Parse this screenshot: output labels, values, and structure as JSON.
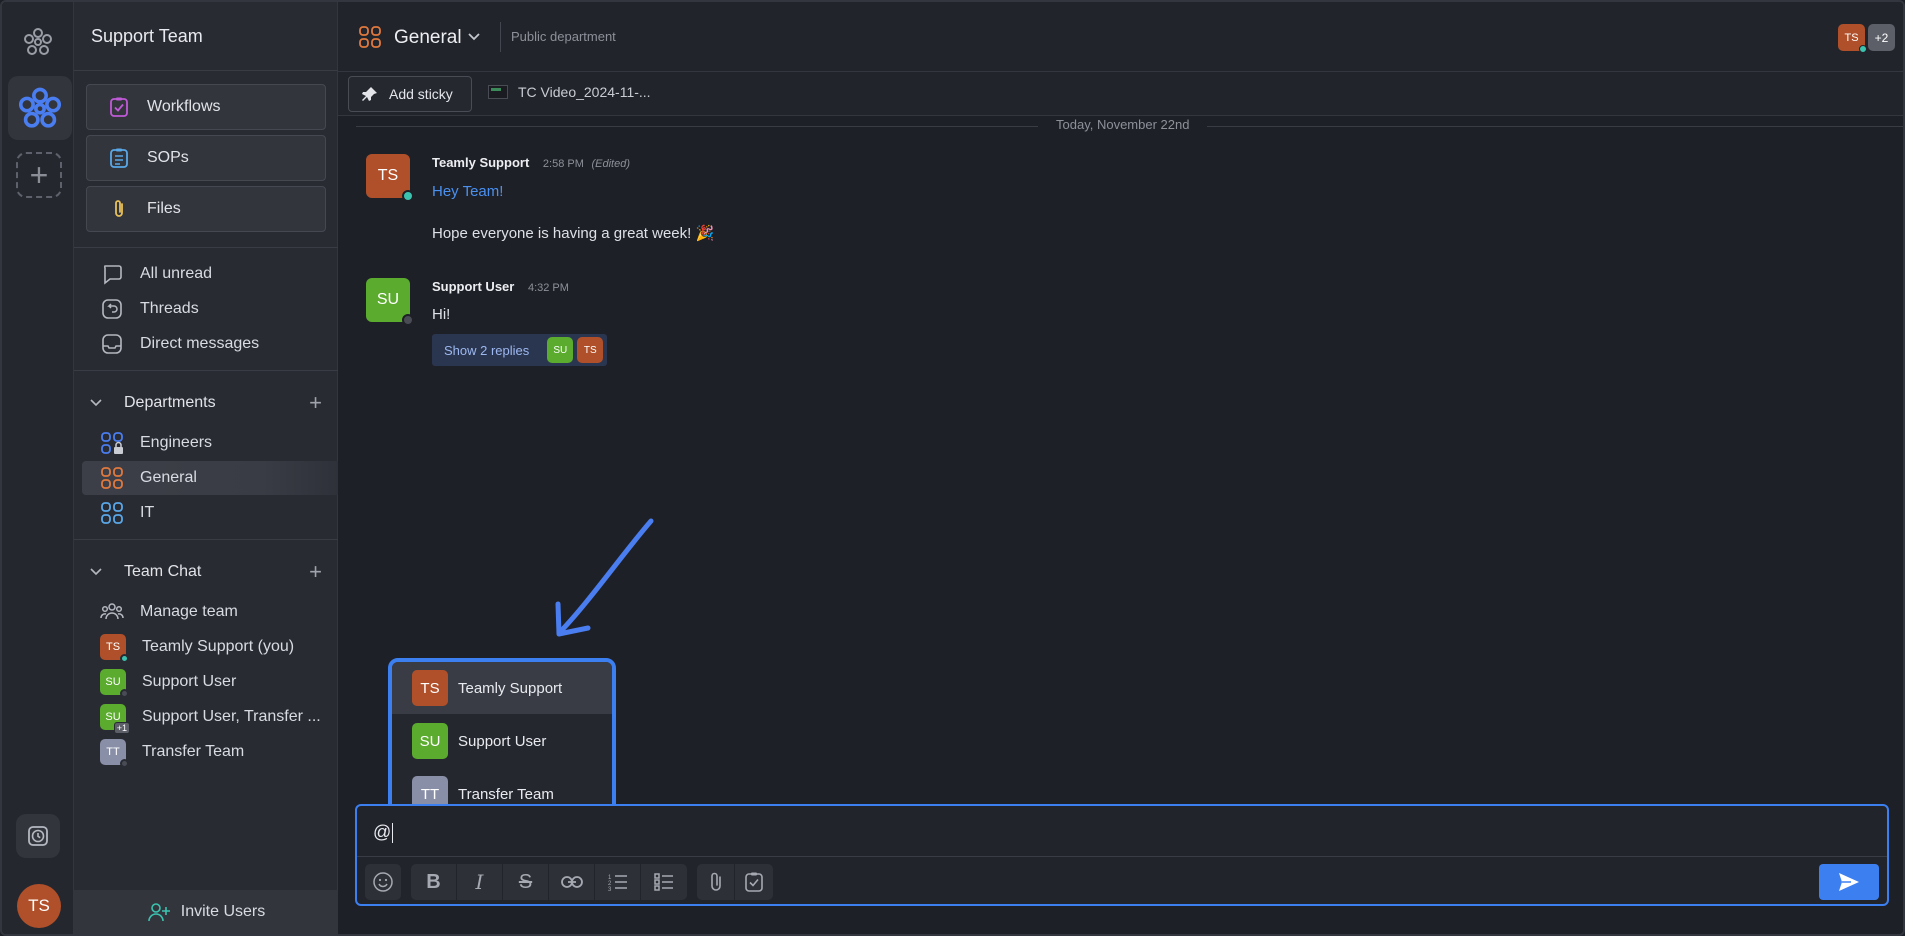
{
  "workspace": {
    "name": "Support Team",
    "user_initials": "TS"
  },
  "sidebar": {
    "buttons": [
      {
        "label": "Workflows",
        "icon": "workflow-icon",
        "color": "#c05ad8"
      },
      {
        "label": "SOPs",
        "icon": "clipboard-list-icon",
        "color": "#5aa8e8"
      },
      {
        "label": "Files",
        "icon": "paperclip-icon",
        "color": "#e8c05a"
      }
    ],
    "nav": [
      {
        "label": "All unread",
        "icon": "chat-bubble-icon"
      },
      {
        "label": "Threads",
        "icon": "threads-icon"
      },
      {
        "label": "Direct messages",
        "icon": "inbox-icon"
      }
    ],
    "departments": {
      "title": "Departments",
      "items": [
        {
          "label": "Engineers",
          "color": "#4a7ef0",
          "locked": true
        },
        {
          "label": "General",
          "color": "#e0793e",
          "active": true
        },
        {
          "label": "IT",
          "color": "#5aa8e8"
        }
      ]
    },
    "team_chat": {
      "title": "Team Chat",
      "manage": "Manage team",
      "items": [
        {
          "label": "Teamly Support (you)",
          "initials": "TS",
          "color": "#b0502a",
          "status": "online"
        },
        {
          "label": "Support User",
          "initials": "SU",
          "color": "#5aab2e",
          "status": "offline"
        },
        {
          "label": "Support User, Transfer ...",
          "initials": "SU",
          "color": "#5aab2e",
          "badge": "+1"
        },
        {
          "label": "Transfer Team",
          "initials": "TT",
          "color": "#8a8fa8",
          "status": "offline"
        }
      ]
    },
    "invite_label": "Invite Users"
  },
  "channel": {
    "name": "General",
    "description": "Public department",
    "members": [
      {
        "initials": "TS",
        "color": "#b0502a"
      },
      {
        "initials": "+2",
        "color": "#5c5f68"
      }
    ]
  },
  "toolbar": {
    "sticky_label": "Add sticky",
    "file_label": "TC Video_2024-11-..."
  },
  "date_divider": "Today, November 22nd",
  "messages": [
    {
      "initials": "TS",
      "color": "#b0502a",
      "status": "online",
      "author": "Teamly Support",
      "time": "2:58 PM",
      "edited": "(Edited)",
      "lines": [
        "Hey Team!",
        "Hope everyone is having a great week! 🎉"
      ]
    },
    {
      "initials": "SU",
      "color": "#5aab2e",
      "status": "offline",
      "author": "Support User",
      "time": "4:32 PM",
      "lines": [
        "Hi!"
      ],
      "replies_label": "Show 2 replies",
      "reply_avatars": [
        {
          "initials": "SU",
          "color": "#5aab2e"
        },
        {
          "initials": "TS",
          "color": "#b0502a"
        }
      ]
    }
  ],
  "mention_popup": [
    {
      "initials": "TS",
      "name": "Teamly Support",
      "color": "#b0502a",
      "selected": true
    },
    {
      "initials": "SU",
      "name": "Support User",
      "color": "#5aab2e"
    },
    {
      "initials": "TT",
      "name": "Transfer Team",
      "color": "#8a8fa8"
    }
  ],
  "composer": {
    "value": "@"
  },
  "colors": {
    "accent": "#3c7ff0",
    "online": "#3cc3b0"
  }
}
